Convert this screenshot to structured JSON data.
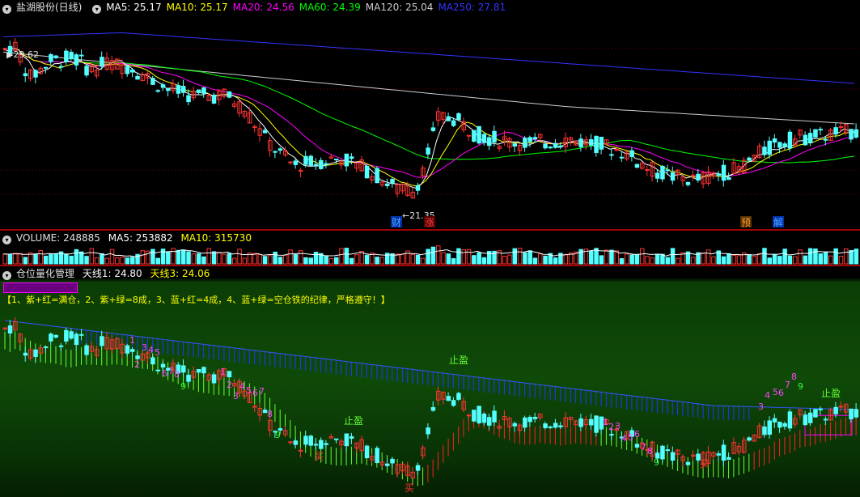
{
  "panel1": {
    "title": "盐湖股份(日线)",
    "ma": [
      {
        "label": "MA5: 25.17",
        "color": "#ffffff"
      },
      {
        "label": "MA10: 25.17",
        "color": "#ffff00"
      },
      {
        "label": "MA20: 24.56",
        "color": "#ff00ff"
      },
      {
        "label": "MA60: 24.39",
        "color": "#00ff00"
      },
      {
        "label": "MA120: 25.04",
        "color": "#cccccc"
      },
      {
        "label": "MA250: 27.81",
        "color": "#3333ff"
      }
    ],
    "high_label": "29.62",
    "low_label": "21.35",
    "markers": [
      {
        "label": "财",
        "color": "#4da6ff",
        "bg": "#0033aa"
      },
      {
        "label": "涨",
        "color": "#ff4040",
        "bg": "#550000"
      },
      {
        "label": "预",
        "color": "#ff9933",
        "bg": "#553300"
      },
      {
        "label": "解",
        "color": "#4da6ff",
        "bg": "#0033aa"
      }
    ]
  },
  "panel2": {
    "title": "VOLUME: 248885",
    "ma5": "MA5: 253882",
    "ma10": "MA10: 315730"
  },
  "panel3": {
    "title": "仓位量化管理",
    "line1": "天线1: 24.80",
    "line3": "天线3: 24.06",
    "rule": "【1、紫+红=满仓，2、紫+绿=8成，3、蓝+红=4成，4、蓝+绿=空仓铁的纪律，严格遵守！】",
    "buy_label": "买",
    "stop_label": "止盈",
    "counts": [
      "1",
      "2",
      "3",
      "4",
      "5",
      "6",
      "7",
      "8",
      "9"
    ]
  },
  "colors": {
    "up": "#ff3333",
    "down": "#54ffff",
    "red_sep": "#a00000"
  }
}
